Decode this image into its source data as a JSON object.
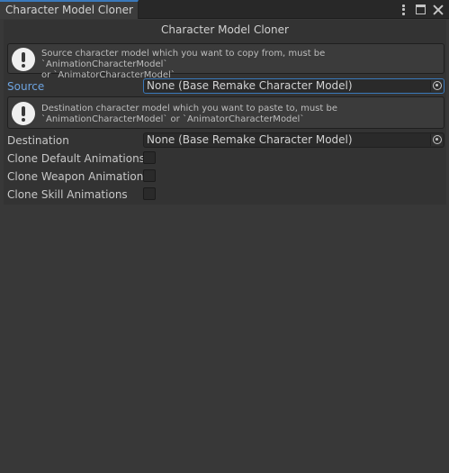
{
  "window": {
    "tab_title": "Character Model Cloner"
  },
  "inspector": {
    "header": "Character Model Cloner",
    "source": {
      "help_line1": "Source character model which you want to copy from, must be `AnimationCharacterModel`",
      "help_line2": "or `AnimatorCharacterModel`",
      "label": "Source",
      "value": "None (Base Remake Character Model)"
    },
    "destination": {
      "help_line1": "Destination character model which you want to paste to, must be",
      "help_line2": "`AnimationCharacterModel` or `AnimatorCharacterModel`",
      "label": "Destination",
      "value": "None (Base Remake Character Model)"
    },
    "toggles": [
      {
        "label": "Clone Default Animations",
        "checked": false
      },
      {
        "label": "Clone Weapon Animations",
        "checked": false
      },
      {
        "label": "Clone Skill Animations",
        "checked": false
      }
    ]
  },
  "colors": {
    "accent": "#3a79bb",
    "active_label": "#6ea4e0",
    "background": "#383838"
  }
}
